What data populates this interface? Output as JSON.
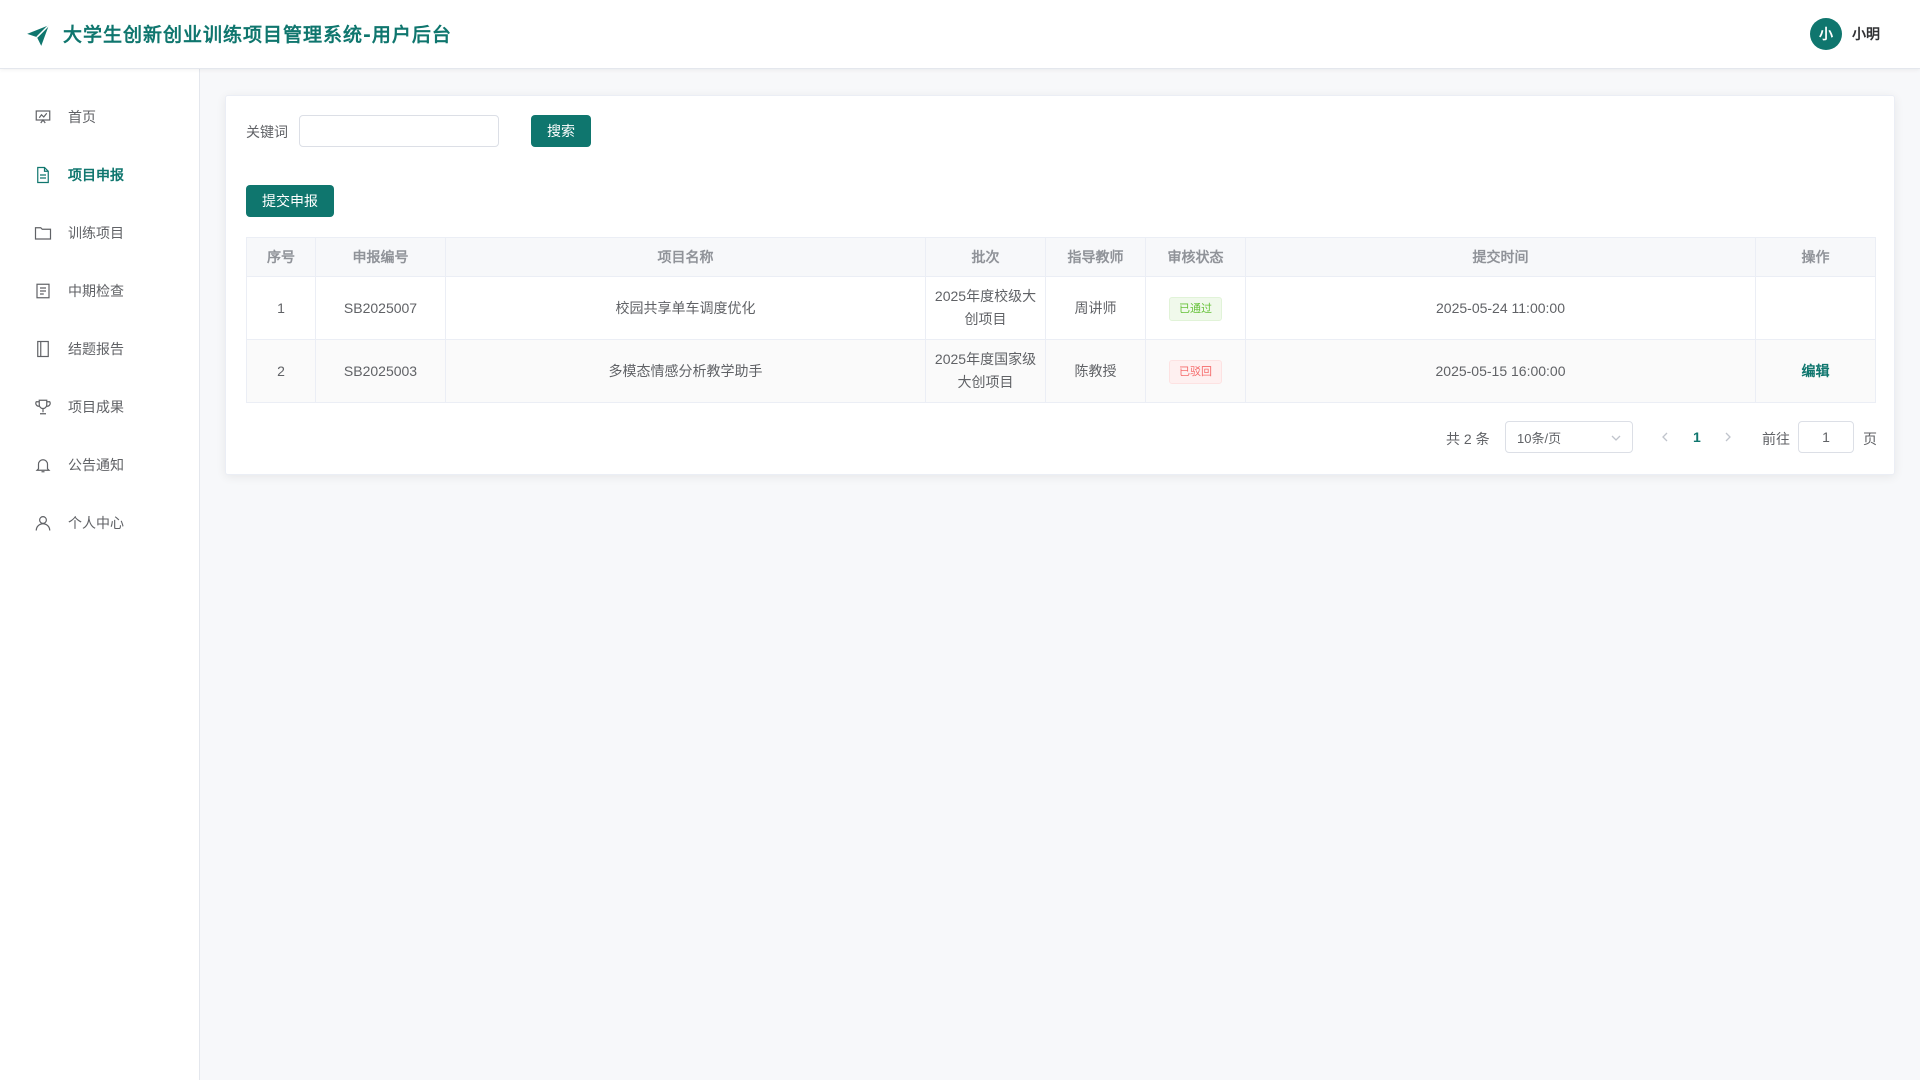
{
  "header": {
    "title": "大学生创新创业训练项目管理系统-用户后台",
    "avatar_text": "小",
    "username": "小明"
  },
  "sidebar": {
    "items": [
      {
        "label": "首页",
        "icon": "dashboard-icon"
      },
      {
        "label": "项目申报",
        "icon": "document-icon",
        "active": true
      },
      {
        "label": "训练项目",
        "icon": "folder-icon"
      },
      {
        "label": "中期检查",
        "icon": "checklist-icon"
      },
      {
        "label": "结题报告",
        "icon": "notebook-icon"
      },
      {
        "label": "项目成果",
        "icon": "trophy-icon"
      },
      {
        "label": "公告通知",
        "icon": "bell-icon"
      },
      {
        "label": "个人中心",
        "icon": "user-icon"
      }
    ]
  },
  "search": {
    "label": "关键词",
    "value": "",
    "placeholder": "",
    "button_label": "搜索"
  },
  "toolbar": {
    "submit_label": "提交申报"
  },
  "table": {
    "headers": [
      "序号",
      "申报编号",
      "项目名称",
      "批次",
      "指导教师",
      "审核状态",
      "提交时间",
      "操作"
    ],
    "rows": [
      {
        "index": "1",
        "code": "SB2025007",
        "name": "校园共享单车调度优化",
        "batch": "2025年度校级大创项目",
        "teacher": "周讲师",
        "status": "已通过",
        "submitted": "2025-05-24 11:00:00",
        "action": ""
      },
      {
        "index": "2",
        "code": "SB2025003",
        "name": "多模态情感分析教学助手",
        "batch": "2025年度国家级大创项目",
        "teacher": "陈教授",
        "status": "已驳回",
        "submitted": "2025-05-15 16:00:00",
        "action": "编辑"
      }
    ]
  },
  "pagination": {
    "total_text": "共 2 条",
    "page_size": "10条/页",
    "current_page": "1",
    "goto_label": "前往",
    "goto_value": "1",
    "page_unit": "页"
  },
  "colors": {
    "accent": "#0f766e",
    "approved": "#67c23a",
    "rejected": "#f56c6c"
  }
}
